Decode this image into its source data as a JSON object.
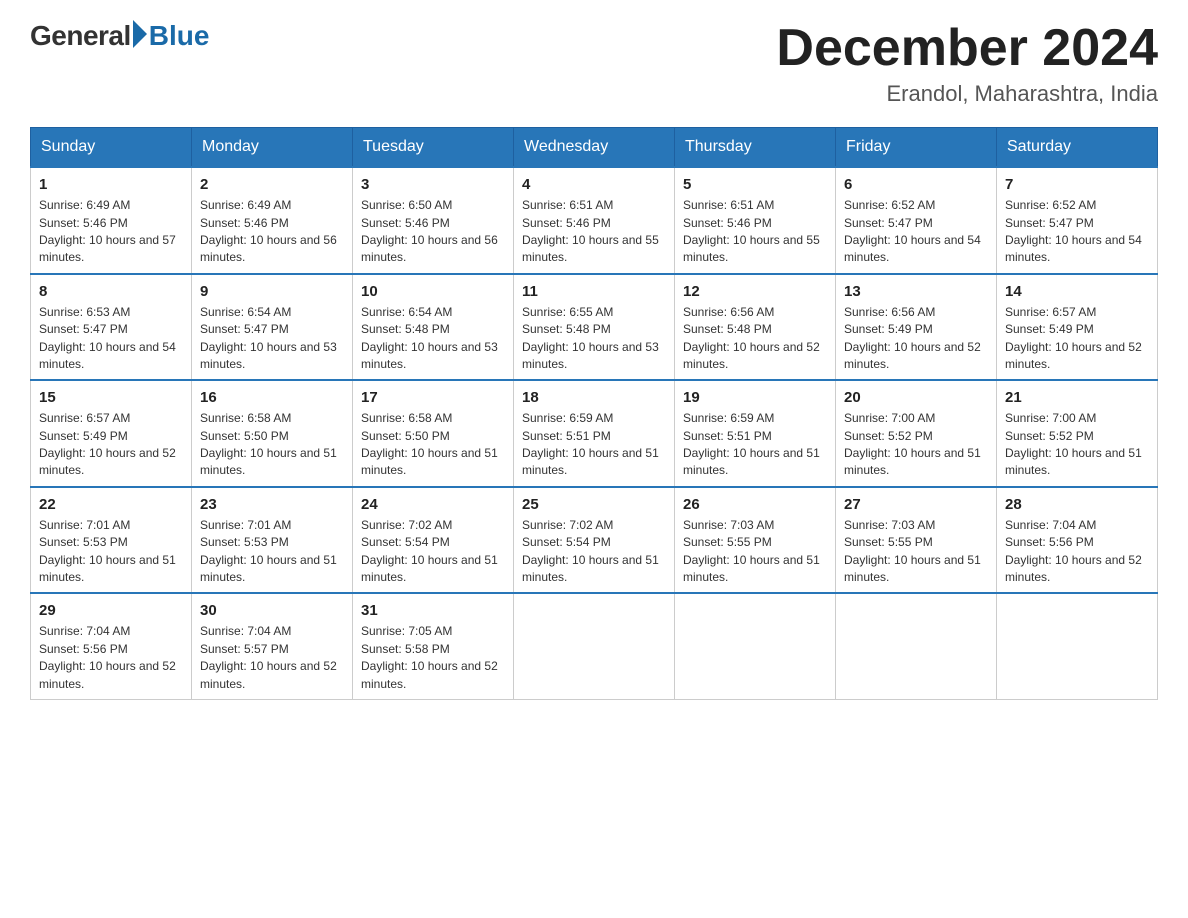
{
  "header": {
    "logo": {
      "general": "General",
      "blue": "Blue"
    },
    "title": "December 2024",
    "subtitle": "Erandol, Maharashtra, India"
  },
  "weekdays": [
    "Sunday",
    "Monday",
    "Tuesday",
    "Wednesday",
    "Thursday",
    "Friday",
    "Saturday"
  ],
  "weeks": [
    [
      {
        "day": 1,
        "sunrise": "6:49 AM",
        "sunset": "5:46 PM",
        "daylight": "10 hours and 57 minutes."
      },
      {
        "day": 2,
        "sunrise": "6:49 AM",
        "sunset": "5:46 PM",
        "daylight": "10 hours and 56 minutes."
      },
      {
        "day": 3,
        "sunrise": "6:50 AM",
        "sunset": "5:46 PM",
        "daylight": "10 hours and 56 minutes."
      },
      {
        "day": 4,
        "sunrise": "6:51 AM",
        "sunset": "5:46 PM",
        "daylight": "10 hours and 55 minutes."
      },
      {
        "day": 5,
        "sunrise": "6:51 AM",
        "sunset": "5:46 PM",
        "daylight": "10 hours and 55 minutes."
      },
      {
        "day": 6,
        "sunrise": "6:52 AM",
        "sunset": "5:47 PM",
        "daylight": "10 hours and 54 minutes."
      },
      {
        "day": 7,
        "sunrise": "6:52 AM",
        "sunset": "5:47 PM",
        "daylight": "10 hours and 54 minutes."
      }
    ],
    [
      {
        "day": 8,
        "sunrise": "6:53 AM",
        "sunset": "5:47 PM",
        "daylight": "10 hours and 54 minutes."
      },
      {
        "day": 9,
        "sunrise": "6:54 AM",
        "sunset": "5:47 PM",
        "daylight": "10 hours and 53 minutes."
      },
      {
        "day": 10,
        "sunrise": "6:54 AM",
        "sunset": "5:48 PM",
        "daylight": "10 hours and 53 minutes."
      },
      {
        "day": 11,
        "sunrise": "6:55 AM",
        "sunset": "5:48 PM",
        "daylight": "10 hours and 53 minutes."
      },
      {
        "day": 12,
        "sunrise": "6:56 AM",
        "sunset": "5:48 PM",
        "daylight": "10 hours and 52 minutes."
      },
      {
        "day": 13,
        "sunrise": "6:56 AM",
        "sunset": "5:49 PM",
        "daylight": "10 hours and 52 minutes."
      },
      {
        "day": 14,
        "sunrise": "6:57 AM",
        "sunset": "5:49 PM",
        "daylight": "10 hours and 52 minutes."
      }
    ],
    [
      {
        "day": 15,
        "sunrise": "6:57 AM",
        "sunset": "5:49 PM",
        "daylight": "10 hours and 52 minutes."
      },
      {
        "day": 16,
        "sunrise": "6:58 AM",
        "sunset": "5:50 PM",
        "daylight": "10 hours and 51 minutes."
      },
      {
        "day": 17,
        "sunrise": "6:58 AM",
        "sunset": "5:50 PM",
        "daylight": "10 hours and 51 minutes."
      },
      {
        "day": 18,
        "sunrise": "6:59 AM",
        "sunset": "5:51 PM",
        "daylight": "10 hours and 51 minutes."
      },
      {
        "day": 19,
        "sunrise": "6:59 AM",
        "sunset": "5:51 PM",
        "daylight": "10 hours and 51 minutes."
      },
      {
        "day": 20,
        "sunrise": "7:00 AM",
        "sunset": "5:52 PM",
        "daylight": "10 hours and 51 minutes."
      },
      {
        "day": 21,
        "sunrise": "7:00 AM",
        "sunset": "5:52 PM",
        "daylight": "10 hours and 51 minutes."
      }
    ],
    [
      {
        "day": 22,
        "sunrise": "7:01 AM",
        "sunset": "5:53 PM",
        "daylight": "10 hours and 51 minutes."
      },
      {
        "day": 23,
        "sunrise": "7:01 AM",
        "sunset": "5:53 PM",
        "daylight": "10 hours and 51 minutes."
      },
      {
        "day": 24,
        "sunrise": "7:02 AM",
        "sunset": "5:54 PM",
        "daylight": "10 hours and 51 minutes."
      },
      {
        "day": 25,
        "sunrise": "7:02 AM",
        "sunset": "5:54 PM",
        "daylight": "10 hours and 51 minutes."
      },
      {
        "day": 26,
        "sunrise": "7:03 AM",
        "sunset": "5:55 PM",
        "daylight": "10 hours and 51 minutes."
      },
      {
        "day": 27,
        "sunrise": "7:03 AM",
        "sunset": "5:55 PM",
        "daylight": "10 hours and 51 minutes."
      },
      {
        "day": 28,
        "sunrise": "7:04 AM",
        "sunset": "5:56 PM",
        "daylight": "10 hours and 52 minutes."
      }
    ],
    [
      {
        "day": 29,
        "sunrise": "7:04 AM",
        "sunset": "5:56 PM",
        "daylight": "10 hours and 52 minutes."
      },
      {
        "day": 30,
        "sunrise": "7:04 AM",
        "sunset": "5:57 PM",
        "daylight": "10 hours and 52 minutes."
      },
      {
        "day": 31,
        "sunrise": "7:05 AM",
        "sunset": "5:58 PM",
        "daylight": "10 hours and 52 minutes."
      },
      null,
      null,
      null,
      null
    ]
  ]
}
